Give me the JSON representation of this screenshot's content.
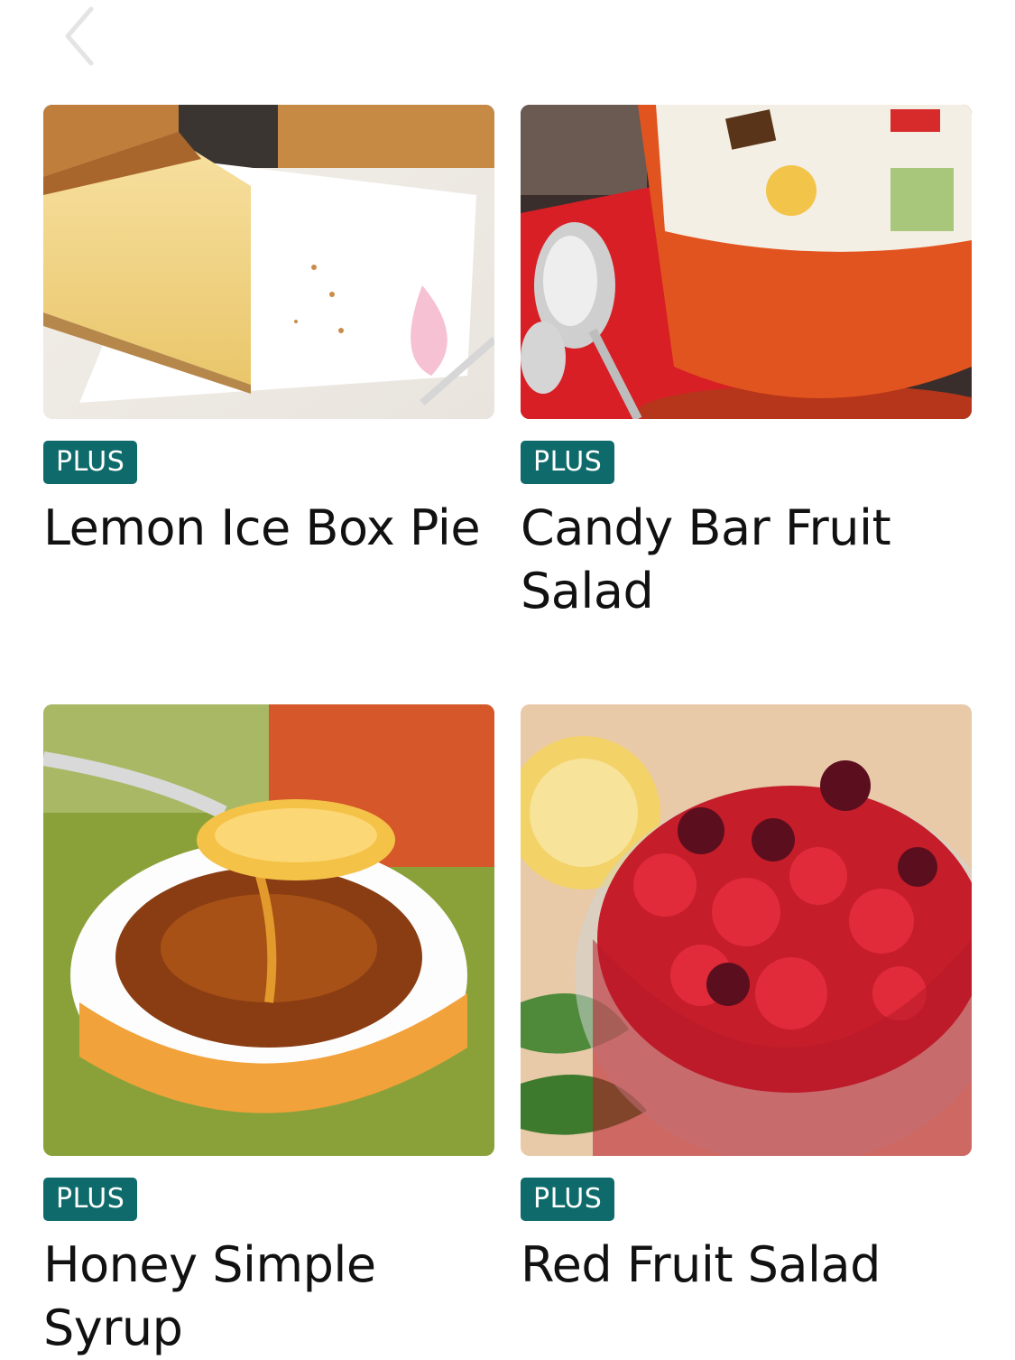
{
  "nav": {
    "back_icon": "chevron-left-icon"
  },
  "recipes": [
    {
      "badge": "PLUS",
      "title": "Lemon Ice Box Pie",
      "image": "lemon-ice-box-pie-photo"
    },
    {
      "badge": "PLUS",
      "title": "Candy Bar Fruit Salad",
      "image": "candy-bar-fruit-salad-photo"
    },
    {
      "badge": "PLUS",
      "title": "Honey Simple Syrup",
      "image": "honey-simple-syrup-photo"
    },
    {
      "badge": "PLUS",
      "title": "Red Fruit Salad",
      "image": "red-fruit-salad-photo"
    }
  ],
  "colors": {
    "badge_bg": "#0f6b6b",
    "badge_text": "#ffffff",
    "title_text": "#111111"
  }
}
